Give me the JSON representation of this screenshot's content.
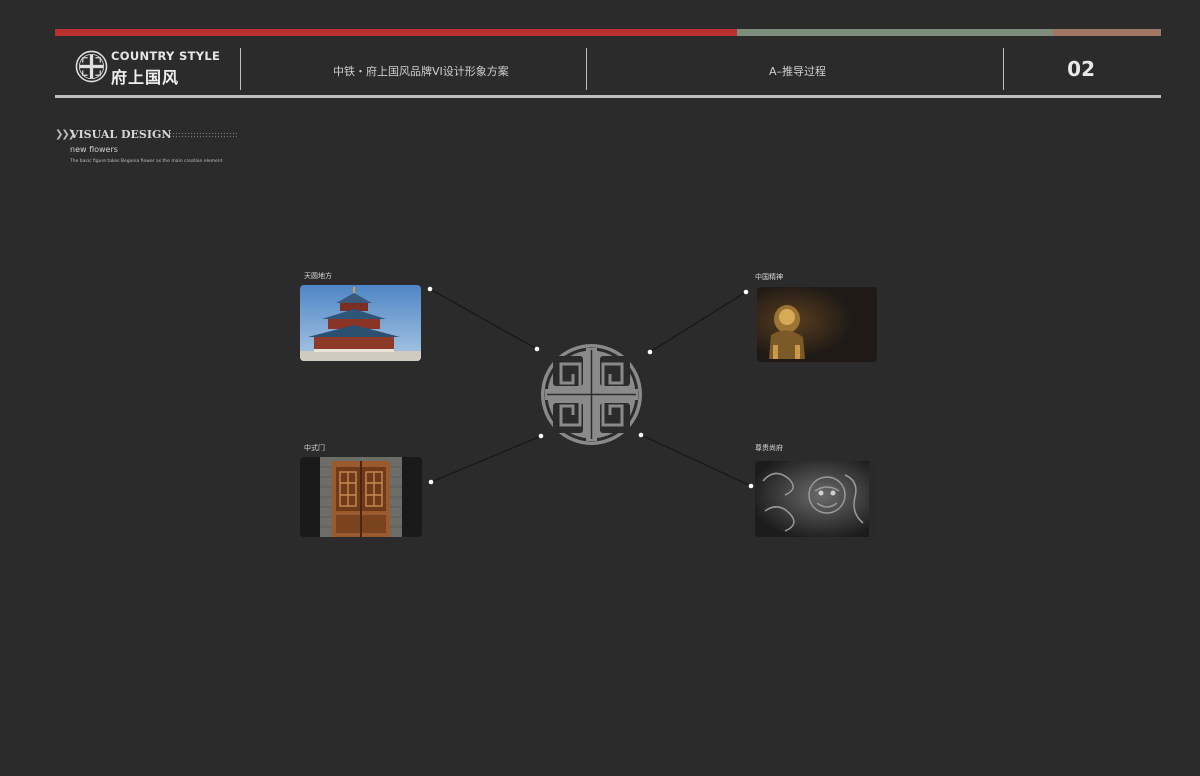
{
  "header": {
    "brand_en": "COUNTRY STYLE",
    "brand_cn": "府上国风",
    "project_title": "中铁・府上国风品牌VI设计形象方案",
    "section_title": "A–推导过程",
    "page_number": "02"
  },
  "section": {
    "title": "VISUAL DESIGN",
    "subtitle": "new flowers",
    "description": "The basic figure takes Begonia flower as the main creation element"
  },
  "cards": [
    {
      "label": "天圆地方",
      "icon": "temple-of-heaven-image"
    },
    {
      "label": "中国精神",
      "icon": "bronze-lion-image"
    },
    {
      "label": "中式门",
      "icon": "chinese-door-image"
    },
    {
      "label": "尊贵尚府",
      "icon": "carved-lion-relief-image"
    }
  ],
  "colors": {
    "background": "#2b2b2b",
    "bar_red": "#b8312e",
    "bar_green": "#7d8f7c",
    "bar_brown": "#a17664",
    "emblem": "#8a8a8a"
  }
}
